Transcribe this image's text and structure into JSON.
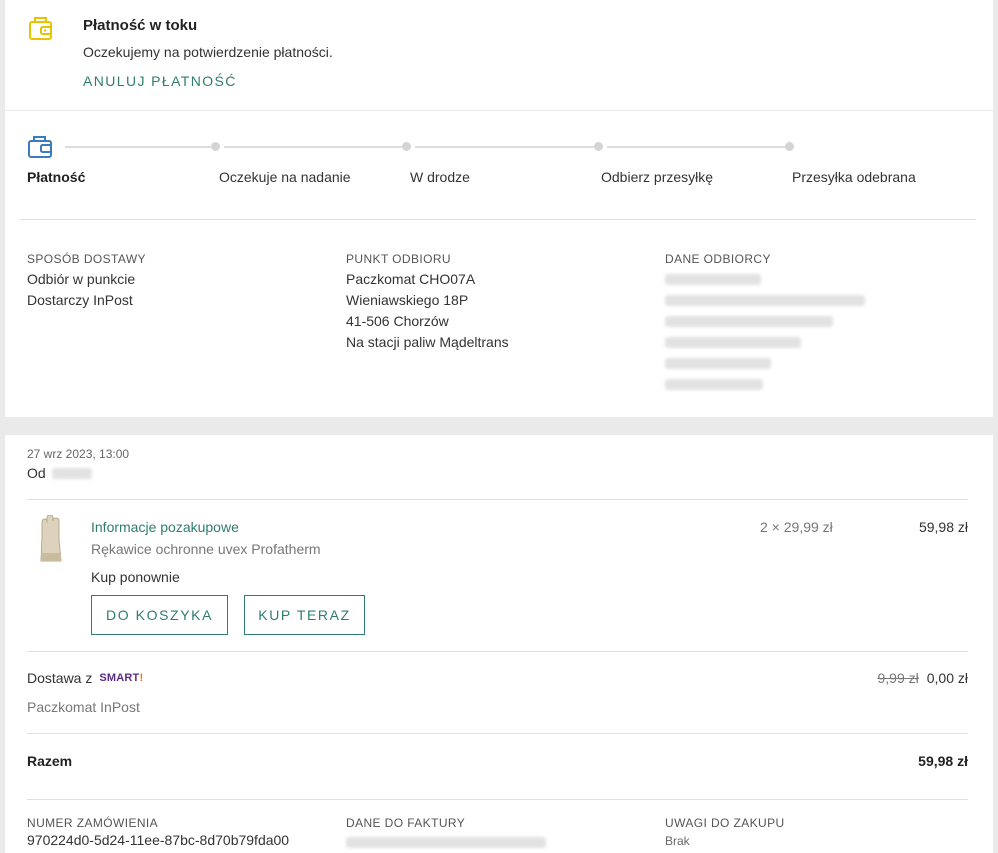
{
  "payment_notice": {
    "title": "Płatność w toku",
    "subtitle": "Oczekujemy na potwierdzenie płatności.",
    "cancel_label": "ANULUJ PŁATNOŚĆ",
    "icon": "wallet-icon",
    "accent_color": "#e8c400"
  },
  "status_steps": [
    {
      "label": "Płatność",
      "active": true
    },
    {
      "label": "Oczekuje na nadanie",
      "active": false
    },
    {
      "label": "W drodze",
      "active": false
    },
    {
      "label": "Odbierz przesyłkę",
      "active": false
    },
    {
      "label": "Przesyłka odebrana",
      "active": false
    }
  ],
  "delivery": {
    "method_heading": "SPOSÓB DOSTAWY",
    "method_lines": [
      "Odbiór w punkcie",
      "Dostarczy InPost"
    ],
    "pickup_heading": "PUNKT ODBIORU",
    "pickup_lines": [
      "Paczkomat CHO07A",
      "Wieniawskiego 18P",
      "41-506 Chorzów",
      "Na stacji paliw Mądeltrans"
    ],
    "recipient_heading": "DANE ODBIORCY"
  },
  "order": {
    "date": "27 wrz 2023, 13:00",
    "from_label": "Od",
    "item": {
      "name": "Informacje pozakupowe",
      "description": "Rękawice ochronne uvex Profatherm",
      "quantity_price": "2 × 29,99 zł",
      "total": "59,98 zł"
    },
    "buy_again_label": "Kup ponownie",
    "to_cart_label": "DO KOSZYKA",
    "buy_now_label": "KUP TERAZ",
    "delivery_label": "Dostawa z",
    "smart_logo": "SMART!",
    "delivery_old_price": "9,99 zł",
    "delivery_price": "0,00 zł",
    "delivery_sub": "Paczkomat InPost",
    "sum_label": "Razem",
    "sum_value": "59,98 zł",
    "order_number_heading": "NUMER ZAMÓWIENIA",
    "order_number": "970224d0-5d24-11ee-87bc-8d70b79fda00",
    "invoice_heading": "DANE DO FAKTURY",
    "notes_heading": "UWAGI DO ZAKUPU",
    "notes_value": "Brak"
  },
  "colors": {
    "accent_teal": "#2f7d70",
    "step_icon_blue": "#3a7cc1",
    "smart_purple": "#5a2c88",
    "smart_orange": "#f07d00"
  }
}
